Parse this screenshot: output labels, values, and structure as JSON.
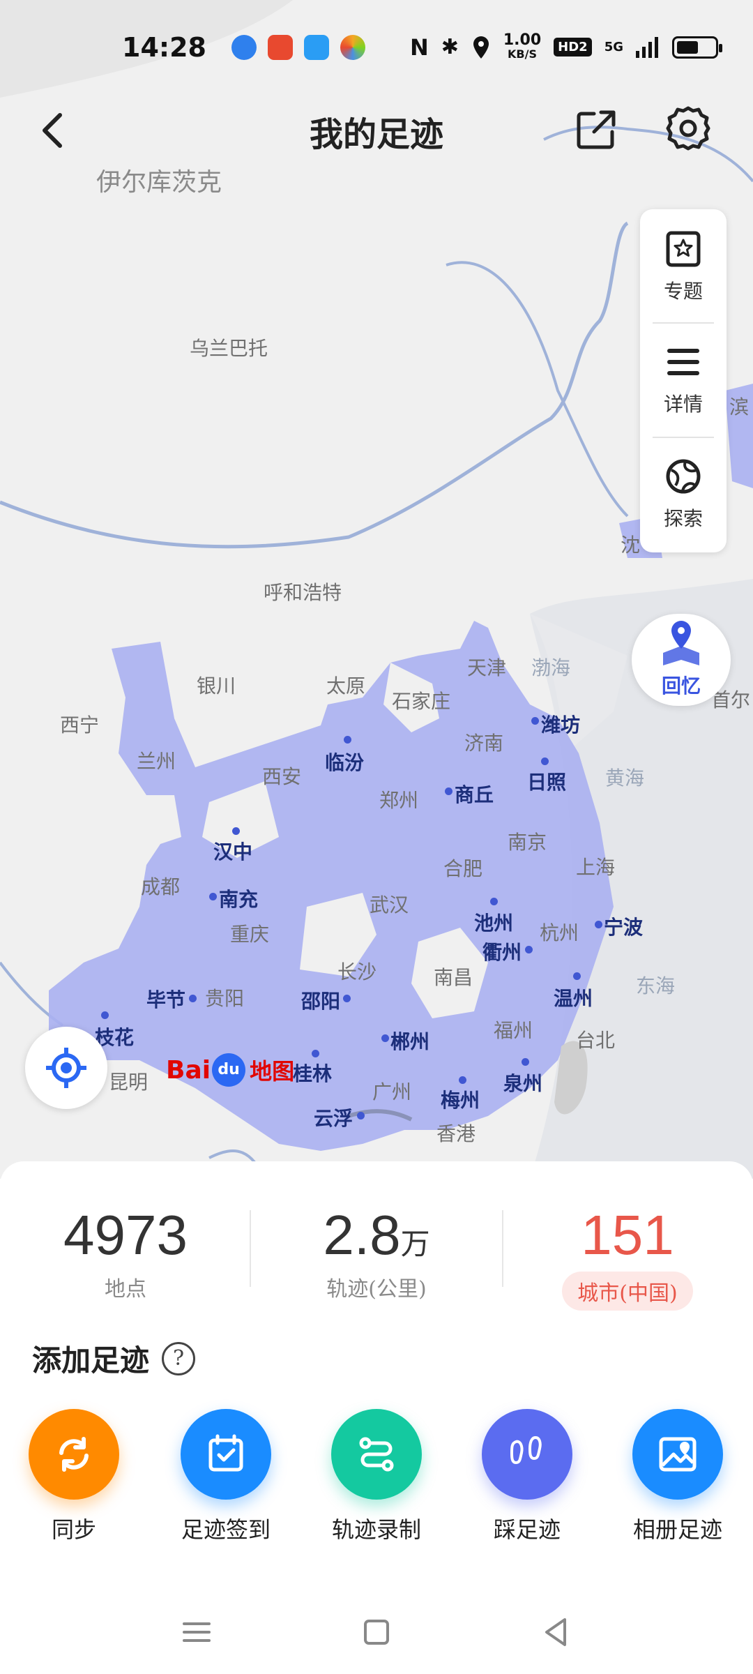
{
  "status_bar": {
    "time": "14:28",
    "net_speed_value": "1.00",
    "net_speed_unit": "KB/S",
    "hd_badge": "HD2",
    "signal_badge": "5G",
    "battery_fraction": 0.55
  },
  "header": {
    "title": "我的足迹"
  },
  "side_menu": {
    "items": [
      {
        "label": "专题",
        "icon": "star-bookmark-icon"
      },
      {
        "label": "详情",
        "icon": "list-icon"
      },
      {
        "label": "探索",
        "icon": "globe-icon"
      }
    ]
  },
  "memory_button": {
    "label": "回忆"
  },
  "map": {
    "logo_brand": "Bai",
    "logo_paw": "du",
    "logo_map": "地图",
    "labels": [
      {
        "text": "伊尔库茨克",
        "type": "other"
      },
      {
        "text": "乌兰巴托",
        "type": "other"
      },
      {
        "text": "呼和浩特",
        "type": "other"
      },
      {
        "text": "银川",
        "type": "other"
      },
      {
        "text": "太原",
        "type": "other"
      },
      {
        "text": "石家庄",
        "type": "other"
      },
      {
        "text": "天津",
        "type": "other"
      },
      {
        "text": "渤海",
        "type": "sea"
      },
      {
        "text": "西宁",
        "type": "other"
      },
      {
        "text": "兰州",
        "type": "other"
      },
      {
        "text": "西安",
        "type": "other"
      },
      {
        "text": "临汾",
        "type": "visited"
      },
      {
        "text": "济南",
        "type": "other"
      },
      {
        "text": "潍坊",
        "type": "visited"
      },
      {
        "text": "日照",
        "type": "visited"
      },
      {
        "text": "黄海",
        "type": "sea"
      },
      {
        "text": "郑州",
        "type": "other"
      },
      {
        "text": "商丘",
        "type": "visited"
      },
      {
        "text": "汉中",
        "type": "visited"
      },
      {
        "text": "南京",
        "type": "other"
      },
      {
        "text": "成都",
        "type": "other"
      },
      {
        "text": "南充",
        "type": "visited"
      },
      {
        "text": "合肥",
        "type": "other"
      },
      {
        "text": "上海",
        "type": "other"
      },
      {
        "text": "武汉",
        "type": "other"
      },
      {
        "text": "重庆",
        "type": "other"
      },
      {
        "text": "池州",
        "type": "visited"
      },
      {
        "text": "杭州",
        "type": "other"
      },
      {
        "text": "宁波",
        "type": "visited"
      },
      {
        "text": "衢州",
        "type": "visited"
      },
      {
        "text": "长沙",
        "type": "other"
      },
      {
        "text": "南昌",
        "type": "other"
      },
      {
        "text": "东海",
        "type": "sea"
      },
      {
        "text": "毕节",
        "type": "visited"
      },
      {
        "text": "贵阳",
        "type": "other"
      },
      {
        "text": "邵阳",
        "type": "visited"
      },
      {
        "text": "温州",
        "type": "visited"
      },
      {
        "text": "枝花",
        "type": "visited"
      },
      {
        "text": "福州",
        "type": "other"
      },
      {
        "text": "台北",
        "type": "other"
      },
      {
        "text": "郴州",
        "type": "visited"
      },
      {
        "text": "昆明",
        "type": "other"
      },
      {
        "text": "桂林",
        "type": "visited"
      },
      {
        "text": "泉州",
        "type": "visited"
      },
      {
        "text": "广州",
        "type": "other"
      },
      {
        "text": "梅州",
        "type": "visited"
      },
      {
        "text": "云浮",
        "type": "visited"
      },
      {
        "text": "香港",
        "type": "other"
      },
      {
        "text": "沈",
        "type": "other"
      },
      {
        "text": "滨",
        "type": "other"
      },
      {
        "text": "首尔",
        "type": "other"
      }
    ]
  },
  "stats": {
    "places": {
      "value": "4973",
      "label": "地点"
    },
    "tracks": {
      "value": "2.8",
      "unit": "万",
      "label": "轨迹(公里)"
    },
    "cities": {
      "value": "151",
      "label": "城市(中国)"
    }
  },
  "add_footprint": {
    "title": "添加足迹",
    "help_glyph": "?",
    "actions": [
      {
        "label": "同步",
        "icon": "sync-icon",
        "color": "#ff8a00"
      },
      {
        "label": "足迹签到",
        "icon": "calendar-check-icon",
        "color": "#1a8cff"
      },
      {
        "label": "轨迹录制",
        "icon": "route-icon",
        "color": "#14c9a0"
      },
      {
        "label": "踩足迹",
        "icon": "footprints-icon",
        "color": "#5b6cf0"
      },
      {
        "label": "相册足迹",
        "icon": "photo-map-icon",
        "color": "#1a8cff"
      }
    ]
  }
}
